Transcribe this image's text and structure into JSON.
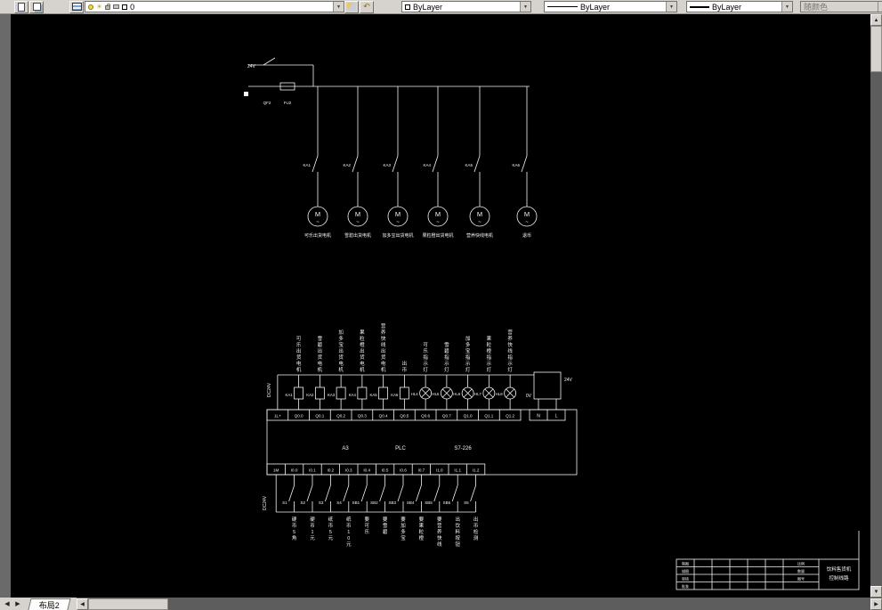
{
  "icons": {
    "dropdown_arrow": "▼",
    "sun": "☀",
    "undo_arrow": "↶",
    "left_arrow": "◀",
    "right_arrow": "▶",
    "up_arrow": "▲",
    "down_arrow": "▼"
  },
  "toolbar": {
    "layer": {
      "value": "0"
    },
    "color": {
      "value": "ByLayer"
    },
    "linetype": {
      "value": "ByLayer"
    },
    "lineweight": {
      "value": "ByLayer"
    },
    "plot_style": {
      "value": "随颜色"
    }
  },
  "layout_tabs": {
    "active": "布局2"
  },
  "colors": {
    "canvas_bg": "#000000",
    "chrome": "#d6d3ce",
    "line_color": "#f5f5f5"
  },
  "schematic": {
    "power": {
      "source_label": "24V",
      "breaker_label": "QF2",
      "fuse_label": "FU2",
      "motor_letter": "M",
      "motor_tilde": "~",
      "branches": [
        {
          "contact": "KA1",
          "name": "可乐出货电机"
        },
        {
          "contact": "KA2",
          "name": "雪碧出货电机"
        },
        {
          "contact": "KA3",
          "name": "加多宝出货电机"
        },
        {
          "contact": "KA4",
          "name": "果粒橙出货电机"
        },
        {
          "contact": "KA5",
          "name": "营养快线电机"
        },
        {
          "contact": "KA6",
          "name": "退币"
        }
      ]
    },
    "plc": {
      "rail_top_label": "DC24V",
      "rail_bottom_label": "DC24V",
      "zero_volt_label": "0V",
      "supply_label": "24V",
      "out_terminals": [
        "1L+",
        "Q0.0",
        "Q0.1",
        "Q0.2",
        "Q0.3",
        "Q0.4",
        "Q0.5",
        "Q0.6",
        "Q0.7",
        "Q1.0",
        "Q1.1",
        "Q1.2"
      ],
      "power_terminals": [
        "N",
        "L"
      ],
      "body_labels": [
        "A3",
        "PLC",
        "S7-226"
      ],
      "in_terminals": [
        "1M",
        "I0.0",
        "I0.1",
        "I0.2",
        "I0.3",
        "I0.4",
        "I0.5",
        "I0.6",
        "I0.7",
        "I1.0",
        "I1.1",
        "I1.2"
      ],
      "loads": [
        {
          "label": "KA1",
          "type": "coil",
          "name": "可乐出货电机"
        },
        {
          "label": "KA2",
          "type": "coil",
          "name": "雪碧出货电机"
        },
        {
          "label": "KA3",
          "type": "coil",
          "name": "加多宝出货电机"
        },
        {
          "label": "KA4",
          "type": "coil",
          "name": "果粒橙出货电机"
        },
        {
          "label": "KA5",
          "type": "coil",
          "name": "营养快线出货电机"
        },
        {
          "label": "KA6",
          "type": "coil",
          "name": "出币"
        },
        {
          "label": "HL4",
          "type": "lamp",
          "name": "可乐指示灯"
        },
        {
          "label": "HL5",
          "type": "lamp",
          "name": "雪碧指示灯"
        },
        {
          "label": "HL6",
          "type": "lamp",
          "name": "加多宝指示灯"
        },
        {
          "label": "HL7",
          "type": "lamp",
          "name": "果粒橙指示灯"
        },
        {
          "label": "HL8",
          "type": "lamp",
          "name": "营养快线指示灯"
        }
      ],
      "inputs": [
        {
          "label": "S1",
          "name": "硬币5角"
        },
        {
          "label": "S2",
          "name": "硬币1元"
        },
        {
          "label": "S3",
          "name": "纸币5元"
        },
        {
          "label": "S4",
          "name": "纸币10元"
        },
        {
          "label": "SB1",
          "name": "要可乐"
        },
        {
          "label": "SB2",
          "name": "要雪碧"
        },
        {
          "label": "SB3",
          "name": "要加多宝"
        },
        {
          "label": "SB4",
          "name": "要果粒橙"
        },
        {
          "label": "SB5",
          "name": "要营养快线"
        },
        {
          "label": "SB6",
          "name": "出饮料按钮"
        },
        {
          "label": "S5",
          "name": "出币检测"
        }
      ]
    },
    "title_block": {
      "title_lines": [
        "饮料售货机",
        "控制线路"
      ],
      "row_labels": [
        "制图",
        "描图",
        "审核",
        "批准"
      ],
      "mid_labels": [
        "比例",
        "数量",
        "图号"
      ]
    }
  }
}
